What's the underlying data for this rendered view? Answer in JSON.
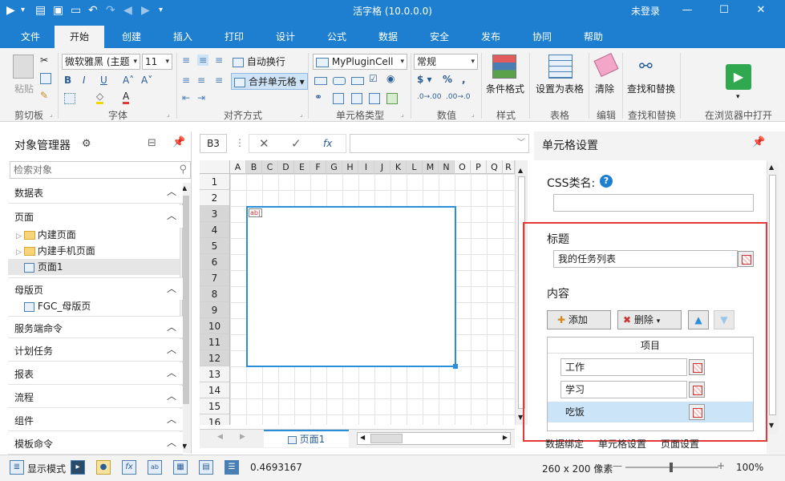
{
  "titlebar": {
    "title": "活字格 (10.0.0.0)",
    "login": "未登录",
    "minimize": "—",
    "maximize": "☐",
    "close": "✕"
  },
  "menu": [
    "文件",
    "开始",
    "创建",
    "插入",
    "打印",
    "设计",
    "公式",
    "数据",
    "安全",
    "发布",
    "协同",
    "帮助"
  ],
  "ribbon": {
    "paste": "粘贴",
    "font_name": "微软雅黑 (主题",
    "font_size": "11",
    "wrap": "自动换行",
    "merge": "合并单元格",
    "celltype_combo": "MyPluginCell",
    "number_format": "常规",
    "cond_format": "条件格式",
    "set_table": "设置为表格",
    "clear": "清除",
    "find_replace": "查找和替换",
    "groups": [
      "剪切板",
      "字体",
      "对齐方式",
      "单元格类型",
      "数值",
      "样式",
      "表格",
      "编辑",
      "查找和替换",
      "在浏览器中打开"
    ]
  },
  "left_panel": {
    "title": "对象管理器",
    "search_placeholder": "检索对象",
    "sections": [
      "数据表",
      "页面",
      "母版页",
      "服务端命令",
      "计划任务",
      "报表",
      "流程",
      "组件",
      "模板命令"
    ],
    "page_nodes": [
      "内建页面",
      "内建手机页面",
      "页面1"
    ],
    "master_nodes": [
      "FGC_母版页"
    ]
  },
  "formula_bar": {
    "cell_ref": "B3",
    "cancel": "✕",
    "confirm": "✓",
    "fx": "fx"
  },
  "grid": {
    "columns": [
      "A",
      "B",
      "C",
      "D",
      "E",
      "F",
      "G",
      "H",
      "I",
      "J",
      "K",
      "L",
      "M",
      "N",
      "O",
      "P",
      "Q",
      "R"
    ],
    "rows": [
      "1",
      "2",
      "3",
      "4",
      "5",
      "6",
      "7",
      "8",
      "9",
      "10",
      "11",
      "12",
      "13",
      "14",
      "15",
      "16"
    ],
    "cell_tag": "ab|"
  },
  "sheet_tab": "页面1",
  "right_panel": {
    "title": "单元格设置",
    "css_label": "CSS类名:",
    "css_value": "",
    "caption_label": "标题",
    "caption_value": "我的任务列表",
    "content_label": "内容",
    "add": "添加",
    "delete": "删除",
    "list_header": "项目",
    "items": [
      "工作",
      "学习",
      "吃饭"
    ],
    "bottom_tabs": [
      "数据绑定",
      "单元格设置",
      "页面设置"
    ]
  },
  "status": {
    "display_mode": "显示模式",
    "value": "0.4693167",
    "size": "260 x 200 像素",
    "zoom": "100%"
  },
  "colors": {
    "accent": "#1e7fd0",
    "highlight": "#e53935",
    "selection": "#2a8ed8"
  }
}
